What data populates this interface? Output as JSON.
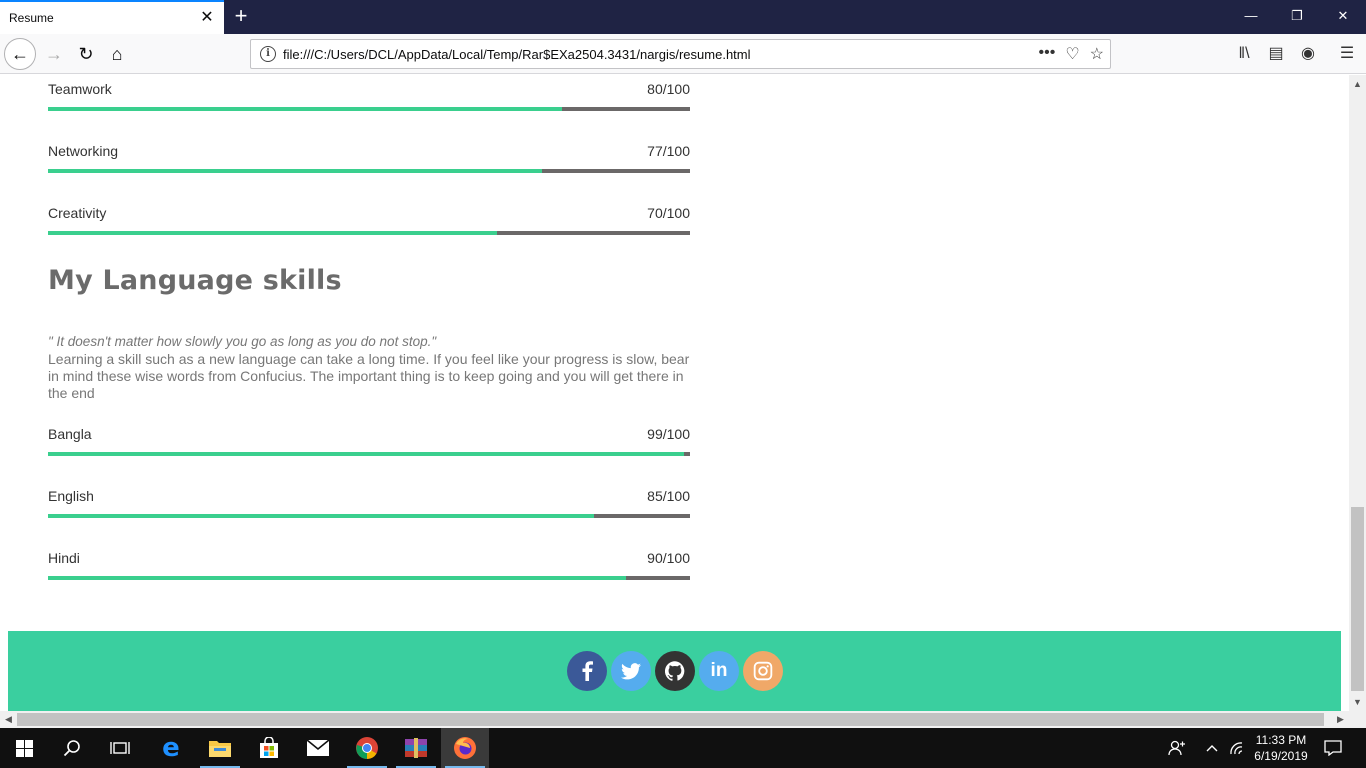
{
  "browser": {
    "tab_title": "Resume",
    "url": "file:///C:/Users/DCL/AppData/Local/Temp/Rar$EXa2504.3431/nargis/resume.html"
  },
  "skills": [
    {
      "name": "Teamwork",
      "score": "80/100",
      "value": 80
    },
    {
      "name": "Networking",
      "score": "77/100",
      "value": 77
    },
    {
      "name": "Creativity",
      "score": "70/100",
      "value": 70
    }
  ],
  "language_section": {
    "title": "My Language skills",
    "quote": "\" It doesn't matter how slowly you go as long as you do not stop.\"",
    "text": "Learning a skill such as a new language can take a long time. If you feel like your progress is slow, bear in mind these wise words from Confucius. The important thing is to keep going and you will get there in the end"
  },
  "languages": [
    {
      "name": "Bangla",
      "score": "99/100",
      "value": 99
    },
    {
      "name": "English",
      "score": "85/100",
      "value": 85
    },
    {
      "name": "Hindi",
      "score": "90/100",
      "value": 90
    }
  ],
  "social": [
    {
      "icon": "facebook-icon",
      "glyph": "f",
      "color": "#3b5998"
    },
    {
      "icon": "twitter-icon",
      "glyph": "t",
      "color": "#55acee"
    },
    {
      "icon": "github-icon",
      "glyph": "gh",
      "color": "#333333"
    },
    {
      "icon": "linkedin-icon",
      "glyph": "in",
      "color": "#55acee"
    },
    {
      "icon": "instagram-icon",
      "glyph": "ig",
      "color": "#f0a868"
    }
  ],
  "colors": {
    "accent": "#3acf8e",
    "bar_track": "#6b6868",
    "footer": "#3acf9f",
    "titlebar": "#1f2344"
  },
  "taskbar": {
    "time": "11:33 PM",
    "date": "6/19/2019"
  }
}
